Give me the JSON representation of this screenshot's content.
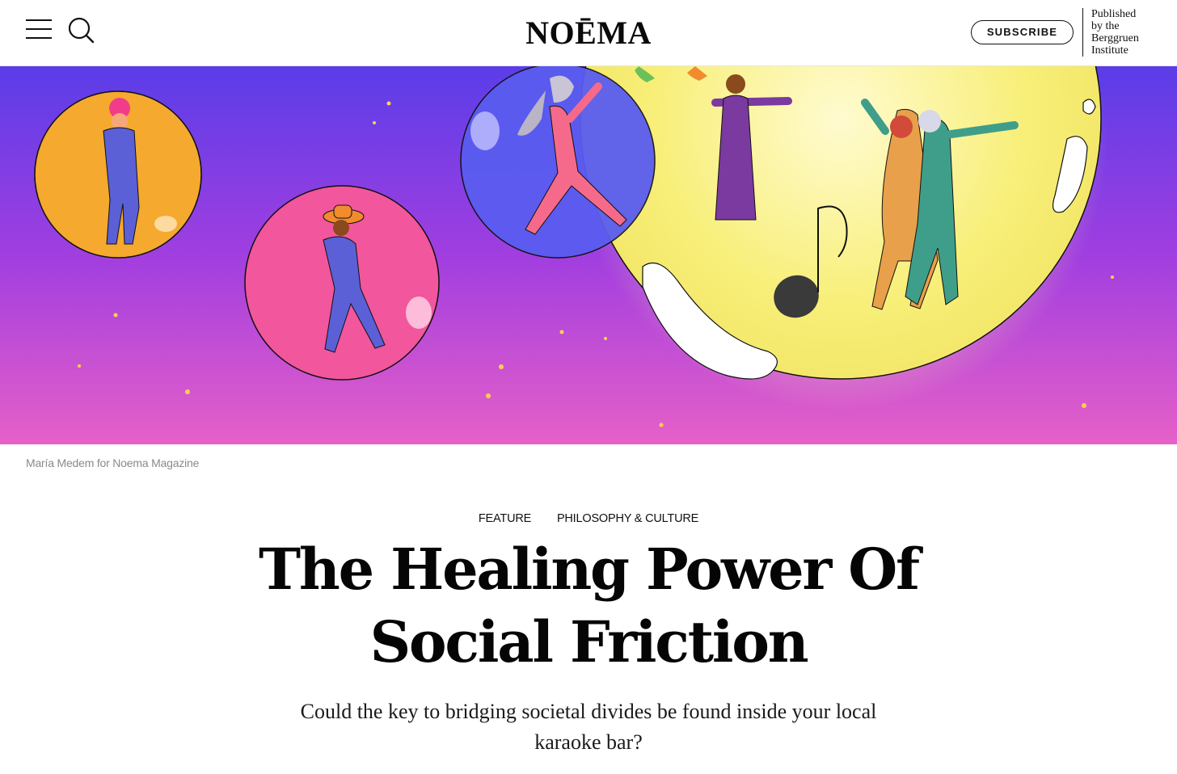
{
  "header": {
    "logo": "NOĒMA",
    "subscribe_label": "SUBSCRIBE",
    "publisher_lines": [
      "Published",
      "by the",
      "Berggruen",
      "Institute"
    ],
    "icons": {
      "menu": "hamburger-menu-icon",
      "search": "search-icon"
    }
  },
  "hero": {
    "caption": "María Medem for Noema Magazine"
  },
  "article": {
    "tags": [
      "FEATURE",
      "PHILOSOPHY & CULTURE"
    ],
    "title_lines": [
      "The Healing Power Of",
      "Social Friction"
    ],
    "dek": "Could the key to bridging societal divides be found inside your local karaoke bar?"
  },
  "colors": {
    "sky_top": "#5a3de8",
    "sky_mid": "#a13ee0",
    "sky_bottom": "#e660c8",
    "moon": "#f8ef7a",
    "bubble_orange": "#f5a92e",
    "bubble_pink": "#f2569c",
    "bubble_blue": "#5a5cf0"
  }
}
